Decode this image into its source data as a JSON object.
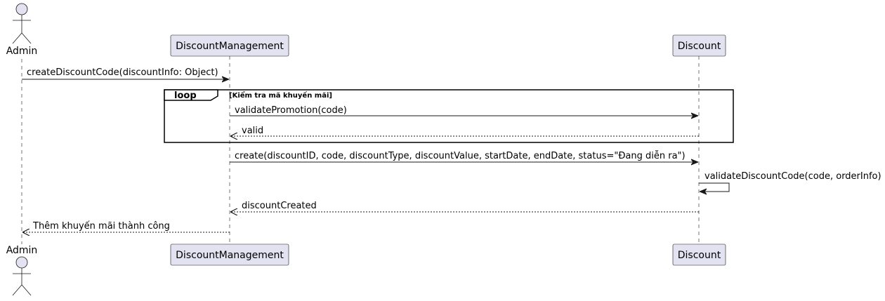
{
  "participants": {
    "admin": "Admin",
    "management": "DiscountManagement",
    "discount": "Discount"
  },
  "messages": [
    "createDiscountCode(discountInfo: Object)",
    "validatePromotion(code)",
    "valid",
    "create(discountID, code, discountType, discountValue, startDate, endDate, status=\"Đang diễn ra\")",
    "validateDiscountCode(code, orderInfo)",
    "discountCreated",
    "Thêm khuyến mãi thành công"
  ],
  "loop": {
    "keyword": "loop",
    "condition": "[Kiểm tra mã khuyến mãi]"
  },
  "colors": {
    "participant_fill": "#E2E2F0",
    "participant_stroke": "#181818",
    "lifeline": "#181818"
  }
}
